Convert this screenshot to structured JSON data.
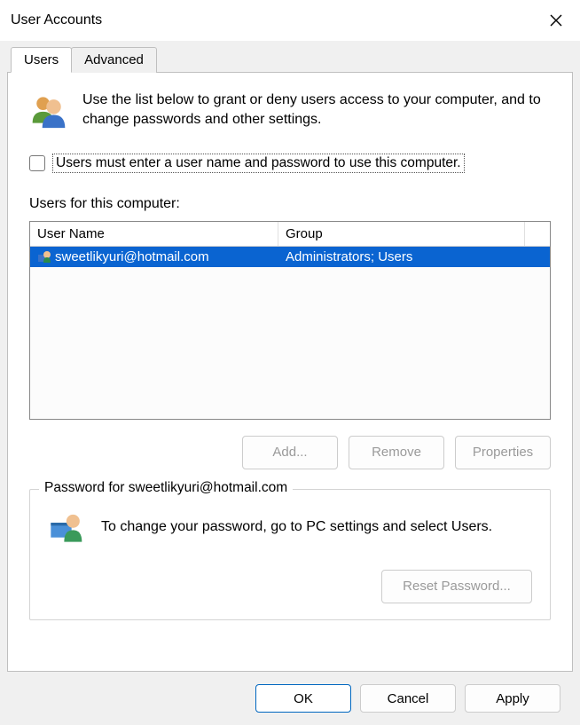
{
  "window": {
    "title": "User Accounts"
  },
  "tabs": [
    {
      "label": "Users",
      "active": true
    },
    {
      "label": "Advanced",
      "active": false
    }
  ],
  "intro": {
    "text": "Use the list below to grant or deny users access to your computer, and to change passwords and other settings."
  },
  "checkbox": {
    "checked": false,
    "label": "Users must enter a user name and password to use this computer."
  },
  "users_list": {
    "label": "Users for this computer:",
    "columns": {
      "name": "User Name",
      "group": "Group"
    },
    "rows": [
      {
        "username": "sweetlikyuri@hotmail.com",
        "group": "Administrators; Users",
        "selected": true
      }
    ]
  },
  "list_buttons": {
    "add": "Add...",
    "remove": "Remove",
    "properties": "Properties"
  },
  "password_section": {
    "legend_prefix": "Password for ",
    "legend_user": "sweetlikyuri@hotmail.com",
    "text": "To change your password, go to PC settings and select Users.",
    "reset_button": "Reset Password..."
  },
  "footer": {
    "ok": "OK",
    "cancel": "Cancel",
    "apply": "Apply"
  }
}
